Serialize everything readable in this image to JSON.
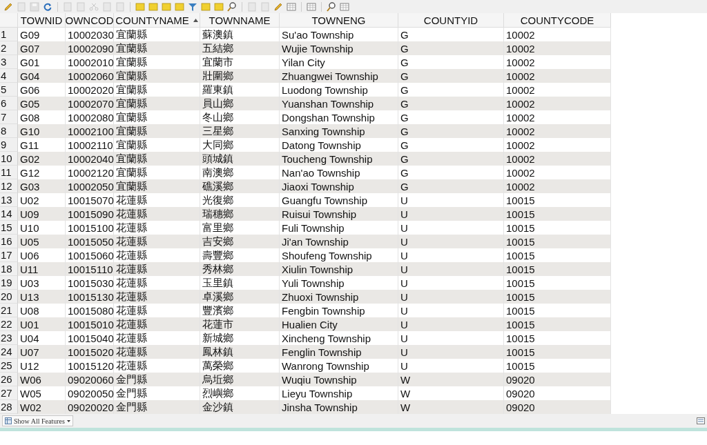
{
  "toolbar": [
    {
      "kind": "pencil",
      "disabled": false
    },
    {
      "kind": "doc",
      "disabled": true
    },
    {
      "kind": "save",
      "disabled": true
    },
    {
      "kind": "refresh",
      "disabled": false
    },
    {
      "kind": "sep"
    },
    {
      "kind": "doc",
      "disabled": true
    },
    {
      "kind": "doc",
      "disabled": true
    },
    {
      "kind": "scissors",
      "disabled": true
    },
    {
      "kind": "doc",
      "disabled": true
    },
    {
      "kind": "doc",
      "disabled": true
    },
    {
      "kind": "sep"
    },
    {
      "kind": "square",
      "disabled": false
    },
    {
      "kind": "square",
      "disabled": false
    },
    {
      "kind": "square",
      "disabled": false
    },
    {
      "kind": "square",
      "disabled": false
    },
    {
      "kind": "filter",
      "disabled": false
    },
    {
      "kind": "square",
      "disabled": false
    },
    {
      "kind": "square",
      "disabled": false
    },
    {
      "kind": "magnifier",
      "disabled": false
    },
    {
      "kind": "sep"
    },
    {
      "kind": "doc",
      "disabled": true
    },
    {
      "kind": "doc",
      "disabled": true
    },
    {
      "kind": "pencil",
      "disabled": false
    },
    {
      "kind": "grid",
      "disabled": false
    },
    {
      "kind": "sep"
    },
    {
      "kind": "grid",
      "disabled": false
    },
    {
      "kind": "sep"
    },
    {
      "kind": "magnifier",
      "disabled": false
    },
    {
      "kind": "grid",
      "disabled": false
    }
  ],
  "table": {
    "columns": [
      {
        "label": "TOWNID",
        "sorted": false
      },
      {
        "label": "OWNCOD",
        "sorted": false
      },
      {
        "label": "COUNTYNAME",
        "sorted": true
      },
      {
        "label": "TOWNNAME",
        "sorted": false
      },
      {
        "label": "TOWNENG",
        "sorted": false
      },
      {
        "label": "COUNTYID",
        "sorted": false
      },
      {
        "label": "COUNTYCODE",
        "sorted": false
      }
    ],
    "rows": [
      {
        "number": "1",
        "cells": [
          "G09",
          "10002030",
          "宜蘭縣",
          "蘇澳鎮",
          "Su'ao Township",
          "G",
          "10002"
        ]
      },
      {
        "number": "2",
        "cells": [
          "G07",
          "10002090",
          "宜蘭縣",
          "五結鄉",
          "Wujie Township",
          "G",
          "10002"
        ]
      },
      {
        "number": "3",
        "cells": [
          "G01",
          "10002010",
          "宜蘭縣",
          "宜蘭市",
          "Yilan City",
          "G",
          "10002"
        ]
      },
      {
        "number": "4",
        "cells": [
          "G04",
          "10002060",
          "宜蘭縣",
          "壯圍鄉",
          "Zhuangwei Township",
          "G",
          "10002"
        ]
      },
      {
        "number": "5",
        "cells": [
          "G06",
          "10002020",
          "宜蘭縣",
          "羅東鎮",
          "Luodong Township",
          "G",
          "10002"
        ]
      },
      {
        "number": "6",
        "cells": [
          "G05",
          "10002070",
          "宜蘭縣",
          "員山鄉",
          "Yuanshan Township",
          "G",
          "10002"
        ]
      },
      {
        "number": "7",
        "cells": [
          "G08",
          "10002080",
          "宜蘭縣",
          "冬山鄉",
          "Dongshan Township",
          "G",
          "10002"
        ]
      },
      {
        "number": "8",
        "cells": [
          "G10",
          "10002100",
          "宜蘭縣",
          "三星鄉",
          "Sanxing Township",
          "G",
          "10002"
        ]
      },
      {
        "number": "9",
        "cells": [
          "G11",
          "10002110",
          "宜蘭縣",
          "大同鄉",
          "Datong Township",
          "G",
          "10002"
        ]
      },
      {
        "number": "10",
        "cells": [
          "G02",
          "10002040",
          "宜蘭縣",
          "頭城鎮",
          "Toucheng Township",
          "G",
          "10002"
        ]
      },
      {
        "number": "11",
        "cells": [
          "G12",
          "10002120",
          "宜蘭縣",
          "南澳鄉",
          "Nan'ao Township",
          "G",
          "10002"
        ]
      },
      {
        "number": "12",
        "cells": [
          "G03",
          "10002050",
          "宜蘭縣",
          "礁溪鄉",
          "Jiaoxi Township",
          "G",
          "10002"
        ]
      },
      {
        "number": "13",
        "cells": [
          "U02",
          "10015070",
          "花蓮縣",
          "光復鄉",
          "Guangfu Township",
          "U",
          "10015"
        ]
      },
      {
        "number": "14",
        "cells": [
          "U09",
          "10015090",
          "花蓮縣",
          "瑞穗鄉",
          "Ruisui Township",
          "U",
          "10015"
        ]
      },
      {
        "number": "15",
        "cells": [
          "U10",
          "10015100",
          "花蓮縣",
          "富里鄉",
          "Fuli Township",
          "U",
          "10015"
        ]
      },
      {
        "number": "16",
        "cells": [
          "U05",
          "10015050",
          "花蓮縣",
          "吉安鄉",
          "Ji'an Township",
          "U",
          "10015"
        ]
      },
      {
        "number": "17",
        "cells": [
          "U06",
          "10015060",
          "花蓮縣",
          "壽豐鄉",
          "Shoufeng Township",
          "U",
          "10015"
        ]
      },
      {
        "number": "18",
        "cells": [
          "U11",
          "10015110",
          "花蓮縣",
          "秀林鄉",
          "Xiulin Township",
          "U",
          "10015"
        ]
      },
      {
        "number": "19",
        "cells": [
          "U03",
          "10015030",
          "花蓮縣",
          "玉里鎮",
          "Yuli Township",
          "U",
          "10015"
        ]
      },
      {
        "number": "20",
        "cells": [
          "U13",
          "10015130",
          "花蓮縣",
          "卓溪鄉",
          "Zhuoxi Township",
          "U",
          "10015"
        ]
      },
      {
        "number": "21",
        "cells": [
          "U08",
          "10015080",
          "花蓮縣",
          "豐濱鄉",
          "Fengbin Township",
          "U",
          "10015"
        ]
      },
      {
        "number": "22",
        "cells": [
          "U01",
          "10015010",
          "花蓮縣",
          "花蓮市",
          "Hualien City",
          "U",
          "10015"
        ]
      },
      {
        "number": "23",
        "cells": [
          "U04",
          "10015040",
          "花蓮縣",
          "新城鄉",
          "Xincheng Township",
          "U",
          "10015"
        ]
      },
      {
        "number": "24",
        "cells": [
          "U07",
          "10015020",
          "花蓮縣",
          "鳳林鎮",
          "Fenglin Township",
          "U",
          "10015"
        ]
      },
      {
        "number": "25",
        "cells": [
          "U12",
          "10015120",
          "花蓮縣",
          "萬榮鄉",
          "Wanrong Township",
          "U",
          "10015"
        ]
      },
      {
        "number": "26",
        "cells": [
          "W06",
          "09020060",
          "金門縣",
          "烏坵鄉",
          "Wuqiu Township",
          "W",
          "09020"
        ]
      },
      {
        "number": "27",
        "cells": [
          "W05",
          "09020050",
          "金門縣",
          "烈嶼鄉",
          "Lieyu Township",
          "W",
          "09020"
        ]
      },
      {
        "number": "28",
        "cells": [
          "W02",
          "09020020",
          "金門縣",
          "金沙鎮",
          "Jinsha Township",
          "W",
          "09020"
        ]
      }
    ]
  },
  "status_bar": {
    "filter_button": "Show All Features"
  }
}
